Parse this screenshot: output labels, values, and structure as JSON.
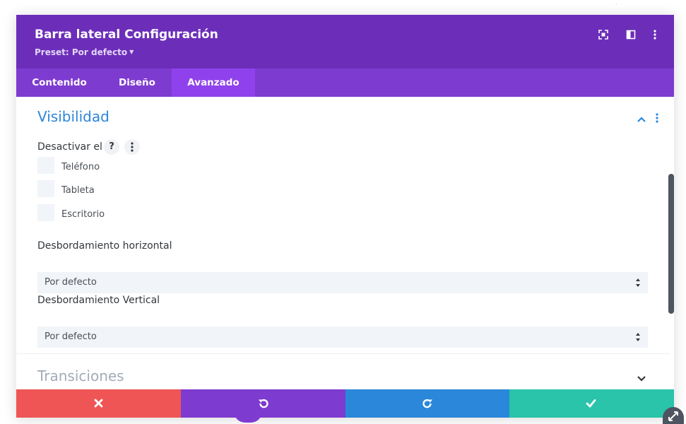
{
  "modal": {
    "title": "Barra lateral Configuración",
    "preset_label": "Preset: Por defecto",
    "header_icons": [
      "expand-icon",
      "sidebar-layout-icon",
      "more-vertical-icon"
    ]
  },
  "tabs": [
    {
      "label": "Contenido",
      "active": false
    },
    {
      "label": "Diseño",
      "active": false
    },
    {
      "label": "Avanzado",
      "active": true
    }
  ],
  "visibility": {
    "title": "Visibilidad",
    "disable_label": "Desactivar el",
    "help_glyph": "?",
    "options": [
      "Teléfono",
      "Tableta",
      "Escritorio"
    ],
    "overflow_x_label": "Desbordamiento horizontal",
    "overflow_x_value": "Por defecto",
    "overflow_y_label": "Desbordamiento Vertical",
    "overflow_y_value": "Por defecto"
  },
  "transitions": {
    "title": "Transiciones"
  },
  "footer": {
    "buttons": [
      {
        "name": "cancel",
        "icon": "close-icon",
        "color": "#ef5555"
      },
      {
        "name": "undo",
        "icon": "undo-icon",
        "color": "#7e3bd0"
      },
      {
        "name": "redo",
        "icon": "redo-icon",
        "color": "#2b87da"
      },
      {
        "name": "save",
        "icon": "check-icon",
        "color": "#29c4a9"
      }
    ]
  },
  "colors": {
    "header": "#6c2eb9",
    "tabs": "#7e3bd0",
    "active_tab": "#8f42ec",
    "accent_blue": "#2b87da"
  }
}
